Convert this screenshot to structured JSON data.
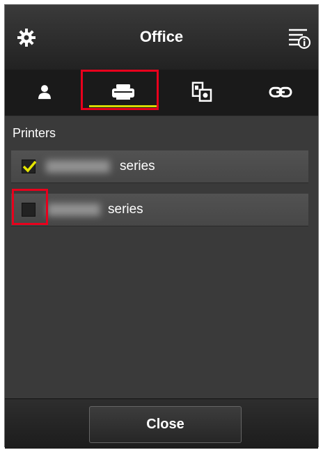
{
  "header": {
    "title": "Office",
    "settings_icon": "gear-icon",
    "info_icon": "info-list-icon"
  },
  "tabs": [
    {
      "name": "users",
      "icon": "user-icon",
      "selected": false
    },
    {
      "name": "printers",
      "icon": "printer-icon",
      "selected": true
    },
    {
      "name": "apps",
      "icon": "apps-icon",
      "selected": false
    },
    {
      "name": "links",
      "icon": "link-icon",
      "selected": false
    }
  ],
  "section": {
    "label": "Printers"
  },
  "printers": [
    {
      "series_label": "series",
      "checked": true
    },
    {
      "series_label": "series",
      "checked": false
    }
  ],
  "footer": {
    "close_label": "Close"
  },
  "colors": {
    "accent_yellow": "#d9d900",
    "highlight_red": "#e8001c"
  }
}
